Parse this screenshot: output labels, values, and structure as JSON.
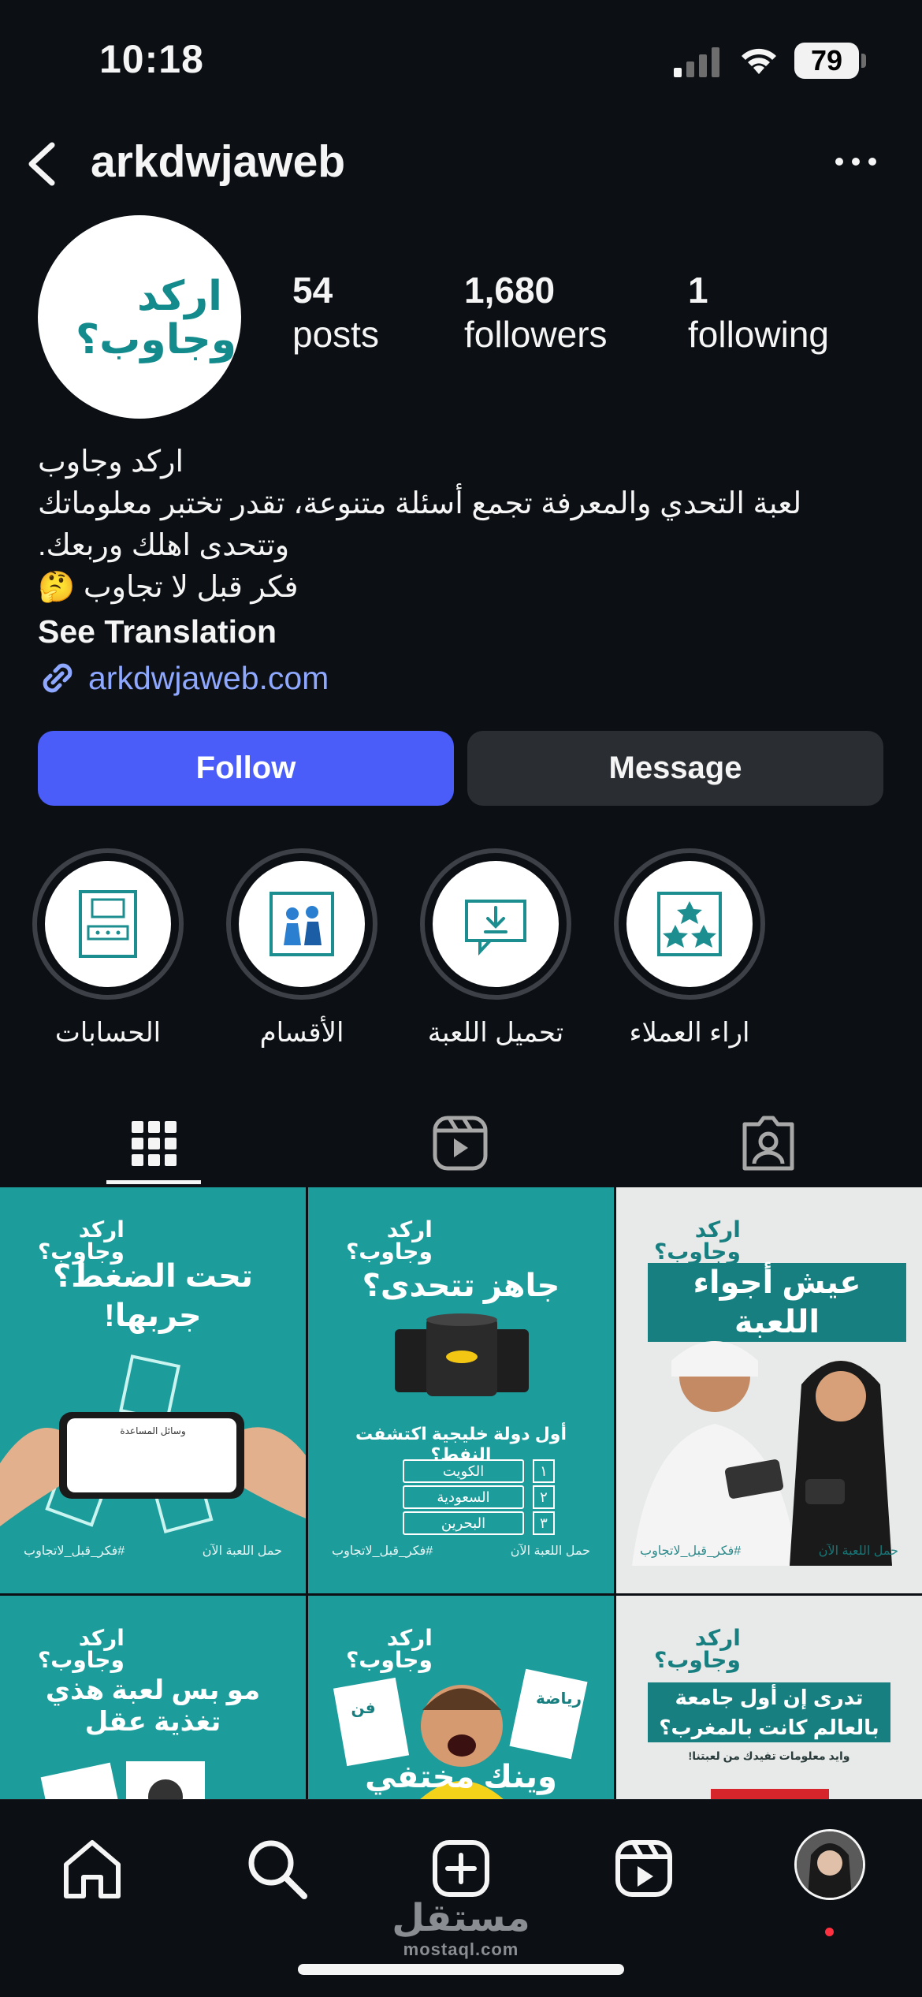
{
  "status_bar": {
    "time": "10:18",
    "battery": "79"
  },
  "header": {
    "username": "arkdwjaweb"
  },
  "profile": {
    "avatar_text": [
      "اركد",
      "وجاوب؟"
    ],
    "stats": [
      {
        "value": "54",
        "label": "posts"
      },
      {
        "value": "1,680",
        "label": "followers"
      },
      {
        "value": "1",
        "label": "following"
      }
    ],
    "bio": {
      "name": "اركد وجاوب",
      "line1": "لعبة التحدي والمعرفة تجمع أسئلة متنوعة، تقدر تختبر معلوماتك",
      "line2": "وتتحدى اهلك وربعك.",
      "line3": "فكر قبل لا تجاوب 🤔",
      "see_translation": "See Translation",
      "website": "arkdwjaweb.com"
    },
    "buttons": {
      "follow": "Follow",
      "message": "Message"
    }
  },
  "highlights": [
    {
      "label": "الحسابات",
      "icon": "accounts-icon"
    },
    {
      "label": "الأقسام",
      "icon": "sections-icon"
    },
    {
      "label": "تحميل اللعبة",
      "icon": "download-icon"
    },
    {
      "label": "اراء العملاء",
      "icon": "stars-icon"
    }
  ],
  "tabs": [
    "grid-icon",
    "reels-icon",
    "tagged-icon"
  ],
  "posts": [
    {
      "headline": "تحت الضغط؟ جربها!",
      "logo": [
        "اركد",
        "وجاوب؟"
      ],
      "sub": "وسائل المساعدة",
      "footer_left": "#فكر_قبل_لاتجاوب",
      "footer_right": "حمل اللعبة الآن"
    },
    {
      "headline": "جاهز تتحدى؟",
      "logo": [
        "اركد",
        "وجاوب؟"
      ],
      "question": "أول دولة خليجية اكتشفت النفط؟",
      "options": [
        {
          "num": "١",
          "text": "الكويت"
        },
        {
          "num": "٢",
          "text": "السعودية"
        },
        {
          "num": "٣",
          "text": "البحرين"
        }
      ],
      "footer_left": "#فكر_قبل_لاتجاوب",
      "footer_right": "حمل اللعبة الآن"
    },
    {
      "headline": "عيش أجواء اللعبة",
      "logo": [
        "اركد",
        "وجاوب؟"
      ],
      "footer_left": "#فكر_قبل_لاتجاوب",
      "footer_right": "حمل اللعبة الآن"
    },
    {
      "headline": "مو بس لعبة هذي تغذية عقل",
      "logo": [
        "اركد",
        "وجاوب؟"
      ]
    },
    {
      "headline": "وينك مختفي",
      "logo": [
        "اركد",
        "وجاوب؟"
      ],
      "card_left": "فن",
      "card_right": "رياضة"
    },
    {
      "headline": "تدرى إن أول جامعة بالعالم كانت بالمغرب؟",
      "logo": [
        "اركد",
        "وجاوب؟"
      ],
      "sub": "وايد معلومات تفيدك من لعبتنا!"
    }
  ],
  "watermark": {
    "arabic": "مستقل",
    "latin": "mostaql.com"
  },
  "colors": {
    "background": "#0c1014",
    "follow": "#4a5df9",
    "message": "#2a2d31",
    "brand_teal": "#1d9c9c",
    "link": "#8fa8ff"
  }
}
